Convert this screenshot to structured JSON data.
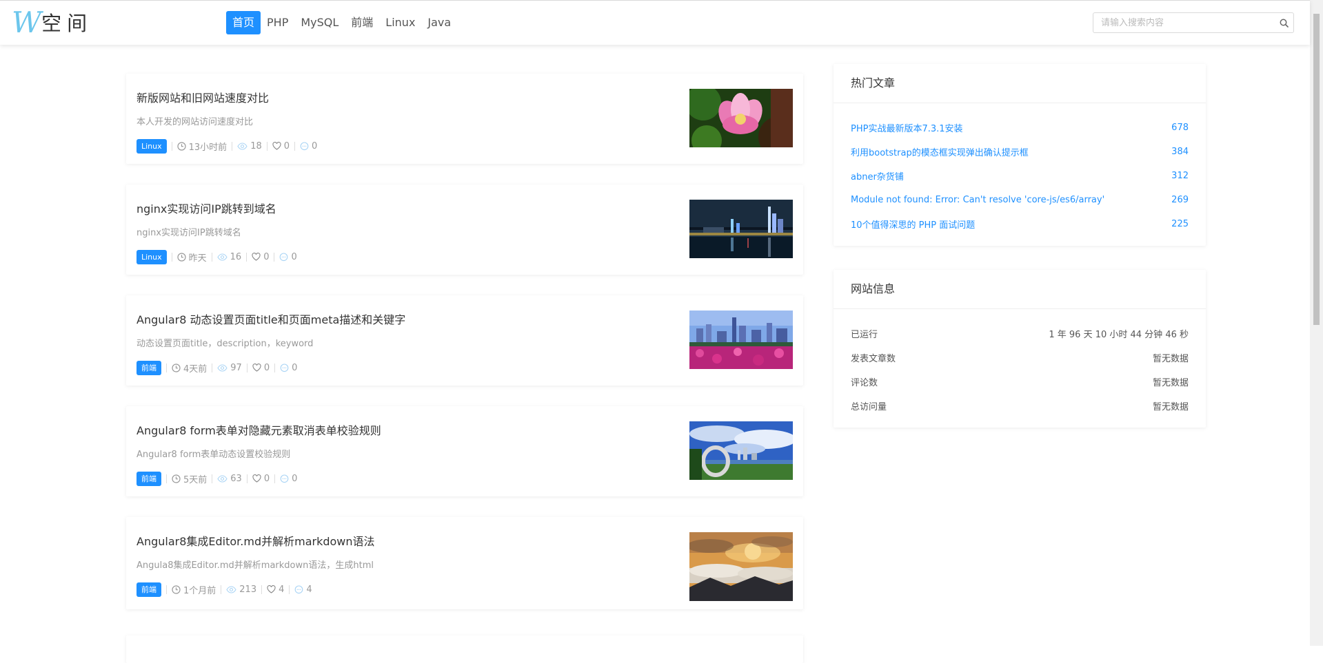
{
  "header": {
    "logo_w": "W",
    "logo_text": "空间",
    "nav": [
      {
        "label": "首页",
        "active": true
      },
      {
        "label": "PHP"
      },
      {
        "label": "MySQL"
      },
      {
        "label": "前端"
      },
      {
        "label": "Linux"
      },
      {
        "label": "Java"
      }
    ],
    "search": {
      "placeholder": "请输入搜索内容",
      "value": ""
    }
  },
  "articles": [
    {
      "title": "新版网站和旧网站速度对比",
      "desc": "本人开发的网站访问速度对比",
      "tag": "Linux",
      "time": "13小时前",
      "views": "18",
      "likes": "0",
      "comments": "0",
      "image": "pink-lotus-flower"
    },
    {
      "title": "nginx实现访问IP跳转到域名",
      "desc": "nginx实现访问IP跳转域名",
      "tag": "Linux",
      "time": "昨天",
      "views": "16",
      "likes": "0",
      "comments": "0",
      "image": "city-night-skyline"
    },
    {
      "title": "Angular8 动态设置页面title和页面meta描述和关键字",
      "desc": "动态设置页面title，description，keyword",
      "tag": "前端",
      "time": "4天前",
      "views": "97",
      "likes": "0",
      "comments": "0",
      "image": "city-skyline-flowers"
    },
    {
      "title": "Angular8 form表单对隐藏元素取消表单校验规则",
      "desc": "Angular8 form表单动态设置校验规则",
      "tag": "前端",
      "time": "5天前",
      "views": "63",
      "likes": "0",
      "comments": "0",
      "image": "park-blue-sky"
    },
    {
      "title": "Angular8集成Editor.md并解析markdown语法",
      "desc": "Angula8集成Editor.md并解析markdown语法，生成html",
      "tag": "前端",
      "time": "1个月前",
      "views": "213",
      "likes": "4",
      "comments": "4",
      "image": "sunset-sea-of-clouds"
    }
  ],
  "hot": {
    "title": "热门文章",
    "items": [
      {
        "title": "PHP实战最新版本7.3.1安装",
        "count": "678"
      },
      {
        "title": "利用bootstrap的模态框实现弹出确认提示框",
        "count": "384"
      },
      {
        "title": "abner杂货铺",
        "count": "312"
      },
      {
        "title": "Module not found: Error: Can't resolve 'core-js/es6/array'",
        "count": "269"
      },
      {
        "title": "10个值得深思的 PHP 面试问题",
        "count": "225"
      }
    ]
  },
  "site_info": {
    "title": "网站信息",
    "rows": [
      {
        "label": "已运行",
        "value": "1 年 96 天 10 小时 44 分钟 46 秒"
      },
      {
        "label": "发表文章数",
        "value": "暂无数据"
      },
      {
        "label": "评论数",
        "value": "暂无数据"
      },
      {
        "label": "总访问量",
        "value": "暂无数据"
      }
    ]
  },
  "colors": {
    "accent": "#1e90ff",
    "logo": "#6cc6ec"
  }
}
